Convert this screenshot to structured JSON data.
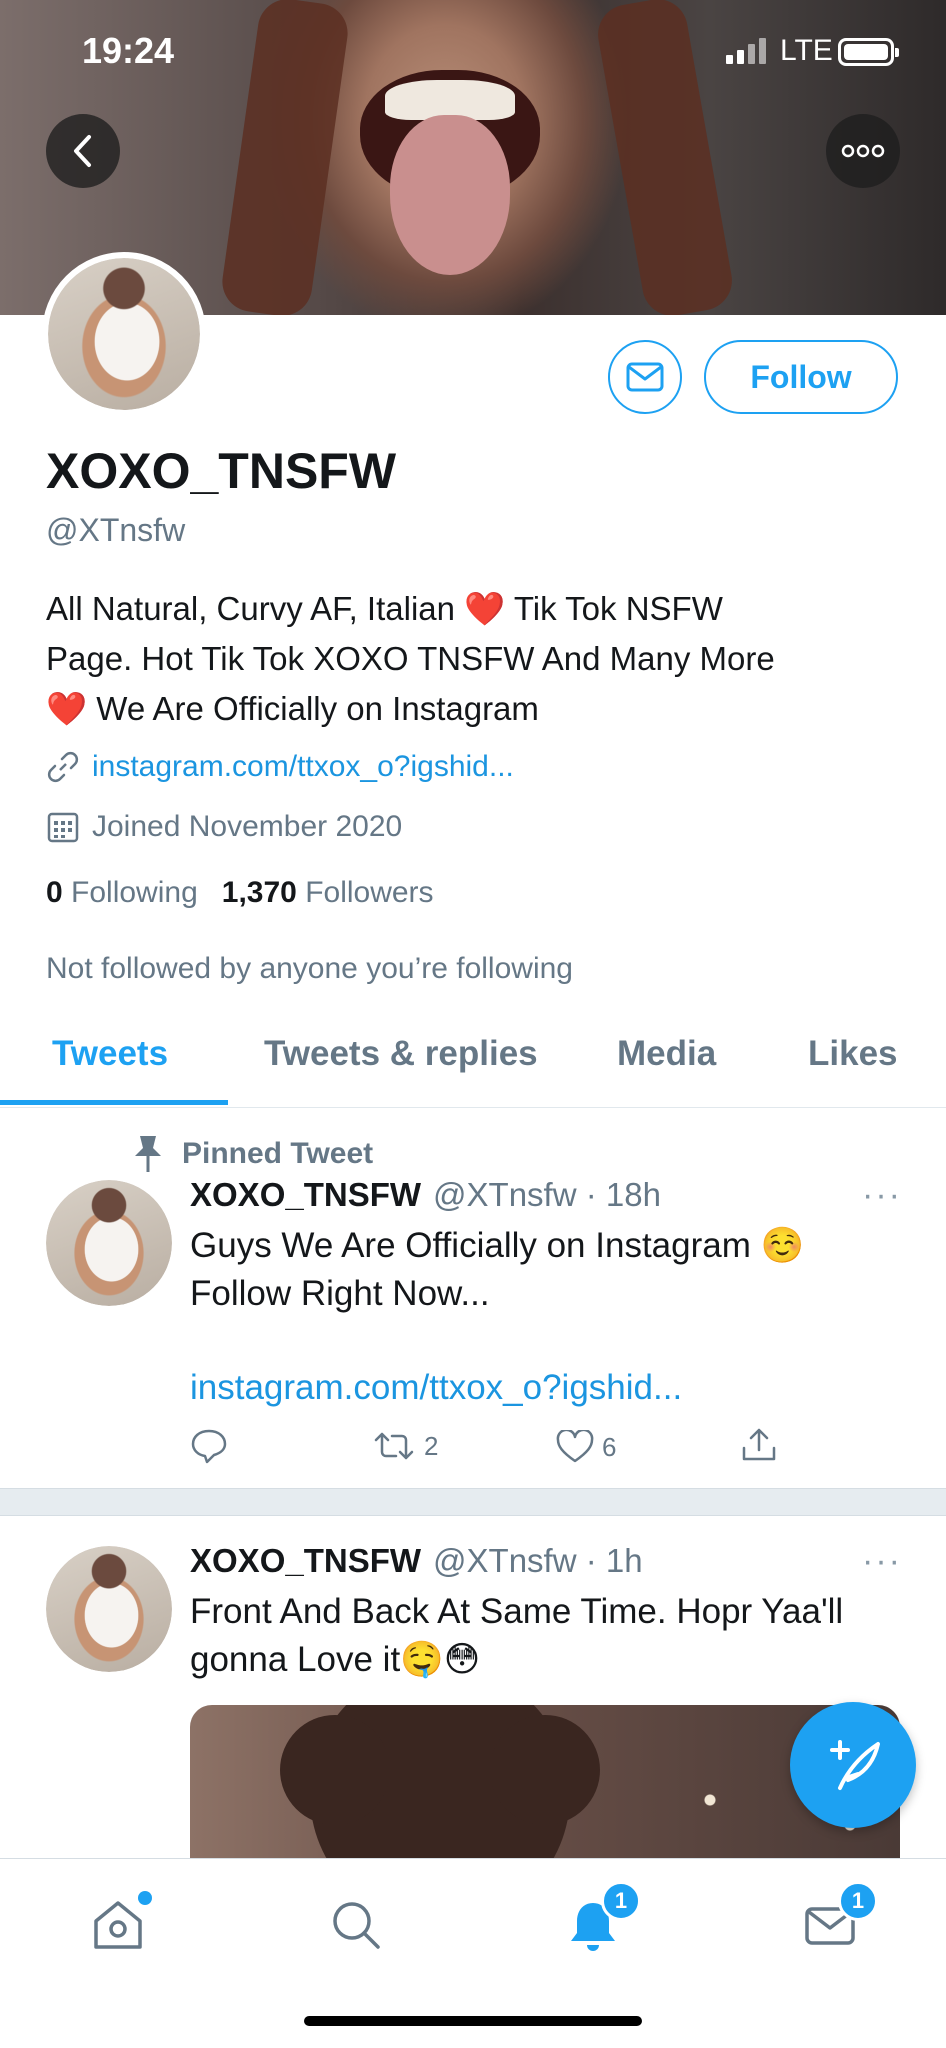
{
  "status_bar": {
    "time": "19:24",
    "carrier": "LTE"
  },
  "profile": {
    "display_name": "XOXO_TNSFW",
    "handle": "@XTnsfw",
    "follow_label": "Follow",
    "bio_line1": "All Natural, Curvy AF, Italian",
    "bio_line1b": "Tik Tok NSFW",
    "bio_line2": "Page. Hot Tik Tok XOXO TNSFW And Many More",
    "bio_line3": "We Are Officially on Instagram",
    "link": "instagram.com/ttxox_o?igshid...",
    "joined": "Joined November 2020",
    "following_count": "0",
    "following_label": "Following",
    "followers_count": "1,370",
    "followers_label": "Followers",
    "not_followed": "Not followed by anyone you’re following"
  },
  "tabs": [
    {
      "label": "Tweets",
      "active": true
    },
    {
      "label": "Tweets & replies",
      "active": false
    },
    {
      "label": "Media",
      "active": false
    },
    {
      "label": "Likes",
      "active": false
    }
  ],
  "tweets": [
    {
      "pinned_label": "Pinned Tweet",
      "name": "XOXO_TNSFW",
      "meta": "@XTnsfw · 18h",
      "text_line1": "Guys We Are Officially on Instagram ☺️",
      "text_line2": "Follow Right Now...",
      "link": "instagram.com/ttxox_o?igshid...",
      "retweets": "2",
      "likes": "6"
    },
    {
      "name": "XOXO_TNSFW",
      "meta": "@XTnsfw · 1h",
      "text_line1": "Front And Back At Same Time. Hopr Yaa'll",
      "text_line2": "gonna Love it🤤😳"
    }
  ],
  "bottom_nav": {
    "notifications_badge": "1",
    "messages_badge": "1"
  },
  "colors": {
    "accent": "#1da1f2",
    "secondary_text": "#657786",
    "heart": "#e0245e"
  }
}
